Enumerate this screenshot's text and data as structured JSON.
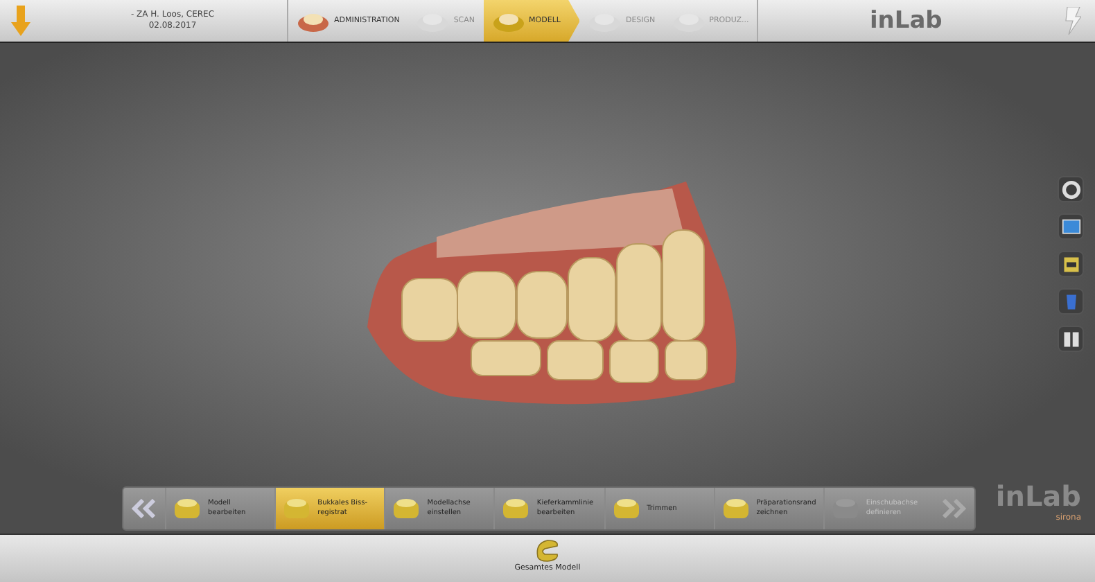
{
  "header": {
    "patient": "- ZA H. Loos, CEREC",
    "date": "02.08.2017",
    "logo": "inLab"
  },
  "phases": [
    {
      "label": "ADMINISTRATION",
      "selected": false,
      "disabled": false
    },
    {
      "label": "SCAN",
      "selected": false,
      "disabled": true
    },
    {
      "label": "MODELL",
      "selected": true,
      "disabled": false
    },
    {
      "label": "DESIGN",
      "selected": false,
      "disabled": true
    },
    {
      "label": "PRODUZ...",
      "selected": false,
      "disabled": true
    }
  ],
  "steps": [
    {
      "label": "Modell bearbeiten",
      "selected": false,
      "disabled": false
    },
    {
      "label": "Bukkales Biss-\nregistrat",
      "selected": true,
      "disabled": false
    },
    {
      "label": "Modellachse einstellen",
      "selected": false,
      "disabled": false
    },
    {
      "label": "Kieferkammlinie bearbeiten",
      "selected": false,
      "disabled": false
    },
    {
      "label": "Trimmen",
      "selected": false,
      "disabled": false
    },
    {
      "label": "Präparationsrand zeichnen",
      "selected": false,
      "disabled": false
    },
    {
      "label": "Einschubachse definieren",
      "selected": false,
      "disabled": true
    }
  ],
  "brand": {
    "product": "inLab",
    "maker": "sirona"
  },
  "footer": {
    "label": "Gesamtes Modell"
  }
}
